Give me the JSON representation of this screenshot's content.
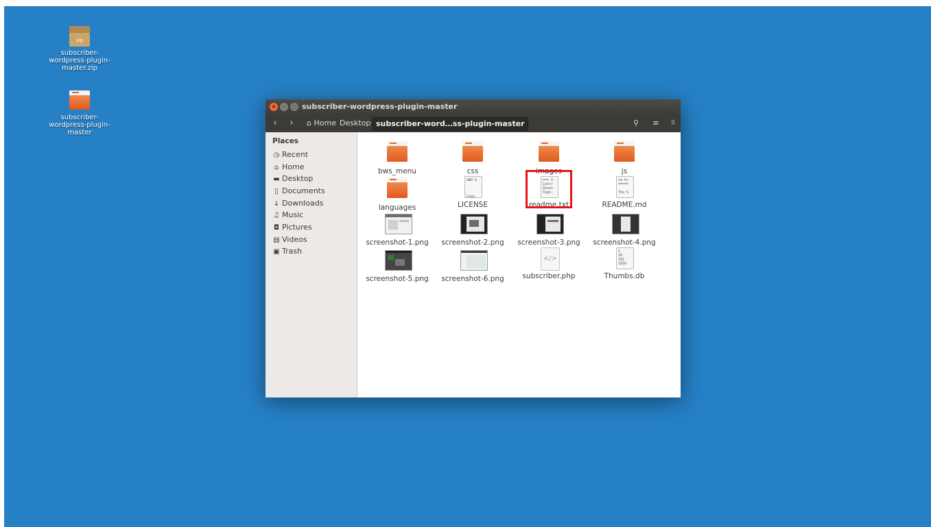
{
  "desktop": {
    "background": "#2680c6",
    "icons": [
      {
        "label": "subscriber-\nwordpress-plugin-\nmaster.zip",
        "icon": "zip-archive-icon",
        "badge": "zip"
      },
      {
        "label": "subscriber-\nwordpress-plugin-\nmaster",
        "icon": "folder-icon"
      }
    ]
  },
  "window": {
    "title": "subscriber-wordpress-plugin-master",
    "controls": {
      "close": "×",
      "minimize": "–",
      "maximize": "▢"
    }
  },
  "toolbar": {
    "back": "‹",
    "forward": "›",
    "breadcrumbs": [
      "Home",
      "Desktop",
      "subscriber-word…ss-plugin-master"
    ],
    "search_icon": "⚲",
    "list_icon": "≡",
    "grid_icon": "⠿"
  },
  "sidebar": {
    "heading": "Places",
    "items": [
      {
        "label": "Recent",
        "icon": "◷"
      },
      {
        "label": "Home",
        "icon": "⌂"
      },
      {
        "label": "Desktop",
        "icon": "▬"
      },
      {
        "label": "Documents",
        "icon": "▯"
      },
      {
        "label": "Downloads",
        "icon": "↓"
      },
      {
        "label": "Music",
        "icon": "♫"
      },
      {
        "label": "Pictures",
        "icon": "◘"
      },
      {
        "label": "Videos",
        "icon": "▤"
      },
      {
        "label": "Trash",
        "icon": "▣"
      }
    ]
  },
  "files": [
    {
      "name": "bws_menu",
      "type": "folder"
    },
    {
      "name": "css",
      "type": "folder"
    },
    {
      "name": "images",
      "type": "folder"
    },
    {
      "name": "js",
      "type": "folder"
    },
    {
      "name": "languages",
      "type": "folder"
    },
    {
      "name": "LICENSE",
      "type": "text",
      "preview": "GNU G\n\n\n\nCopy"
    },
    {
      "name": "readme.txt",
      "type": "text",
      "preview": "=== S\nContr\nDonat\nTags:"
    },
    {
      "name": "README.md",
      "type": "text",
      "preview": "<a hr\n=====\n\nThe S"
    },
    {
      "name": "screenshot-1.png",
      "type": "image"
    },
    {
      "name": "screenshot-2.png",
      "type": "image"
    },
    {
      "name": "screenshot-3.png",
      "type": "image"
    },
    {
      "name": "screenshot-4.png",
      "type": "image"
    },
    {
      "name": "screenshot-5.png",
      "type": "image"
    },
    {
      "name": "screenshot-6.png",
      "type": "image"
    },
    {
      "name": "subscriber.php",
      "type": "code",
      "preview": "</>"
    },
    {
      "name": "Thumbs.db",
      "type": "text",
      "preview": "1\n10\n101\n1010"
    }
  ],
  "highlight": {
    "target": "readme.txt",
    "color": "#e8131a"
  }
}
